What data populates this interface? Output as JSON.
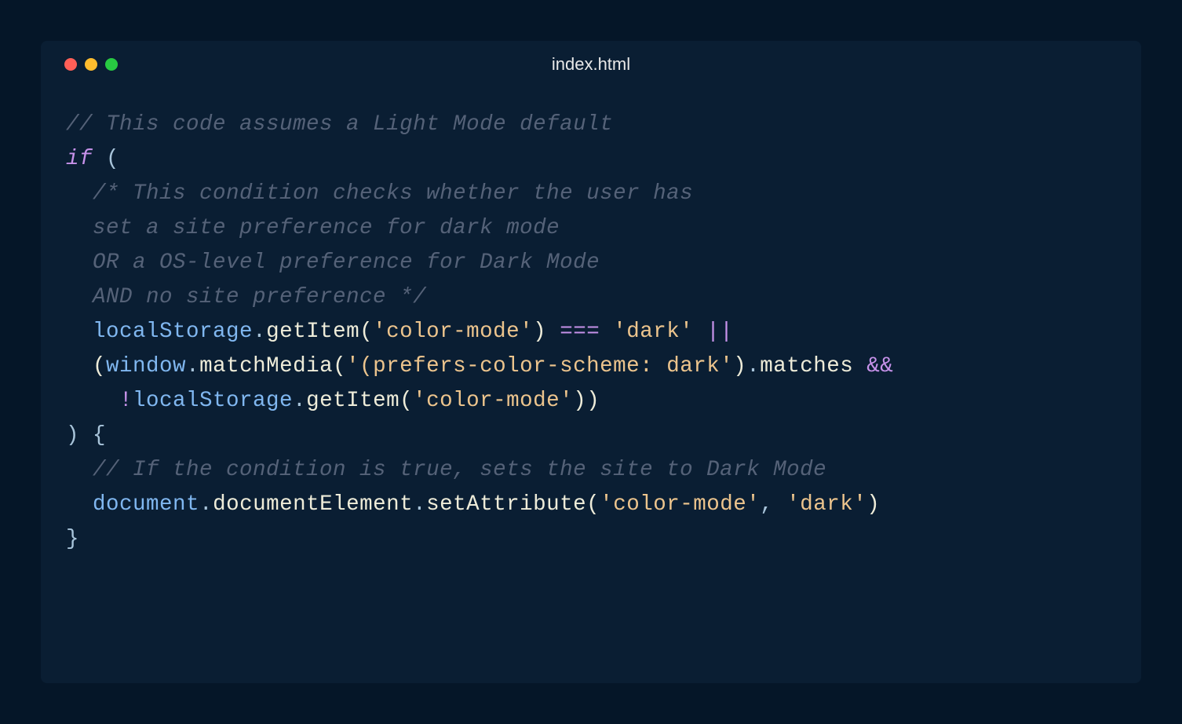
{
  "window": {
    "title": "index.html"
  },
  "code": {
    "line1_comment": "// This code assumes a Light Mode default",
    "line2_if": "if",
    "line2_paren": " (",
    "line3_comment": "  /* This condition checks whether the user has",
    "line4_comment": "  set a site preference for dark mode",
    "line5_comment": "  OR a OS-level preference for Dark Mode",
    "line6_comment": "  AND no site preference */",
    "line7_indent": "  ",
    "line7_localStorage": "localStorage",
    "line7_dot1": ".",
    "line7_getItem": "getItem",
    "line7_open": "(",
    "line7_str": "'color-mode'",
    "line7_close": ")",
    "line7_eq": " === ",
    "line7_str2": "'dark'",
    "line7_or": " ||",
    "line8_indent": "  ",
    "line8_openparen": "(",
    "line8_window": "window",
    "line8_dot1": ".",
    "line8_matchMedia": "matchMedia",
    "line8_open": "(",
    "line8_str": "'(prefers-color-scheme: dark'",
    "line8_close": ")",
    "line8_dot2": ".",
    "line8_matches": "matches",
    "line8_and": " &&",
    "line9_indent": "    ",
    "line9_not": "!",
    "line9_localStorage": "localStorage",
    "line9_dot": ".",
    "line9_getItem": "getItem",
    "line9_open": "(",
    "line9_str": "'color-mode'",
    "line9_close": "))",
    "line10": ") {",
    "line11_comment": "  // If the condition is true, sets the site to Dark Mode",
    "line12_indent": "  ",
    "line12_document": "document",
    "line12_dot1": ".",
    "line12_documentElement": "documentElement",
    "line12_dot2": ".",
    "line12_setAttribute": "setAttribute",
    "line12_open": "(",
    "line12_str1": "'color-mode'",
    "line12_comma": ", ",
    "line12_str2": "'dark'",
    "line12_close": ")",
    "line13": "}"
  }
}
